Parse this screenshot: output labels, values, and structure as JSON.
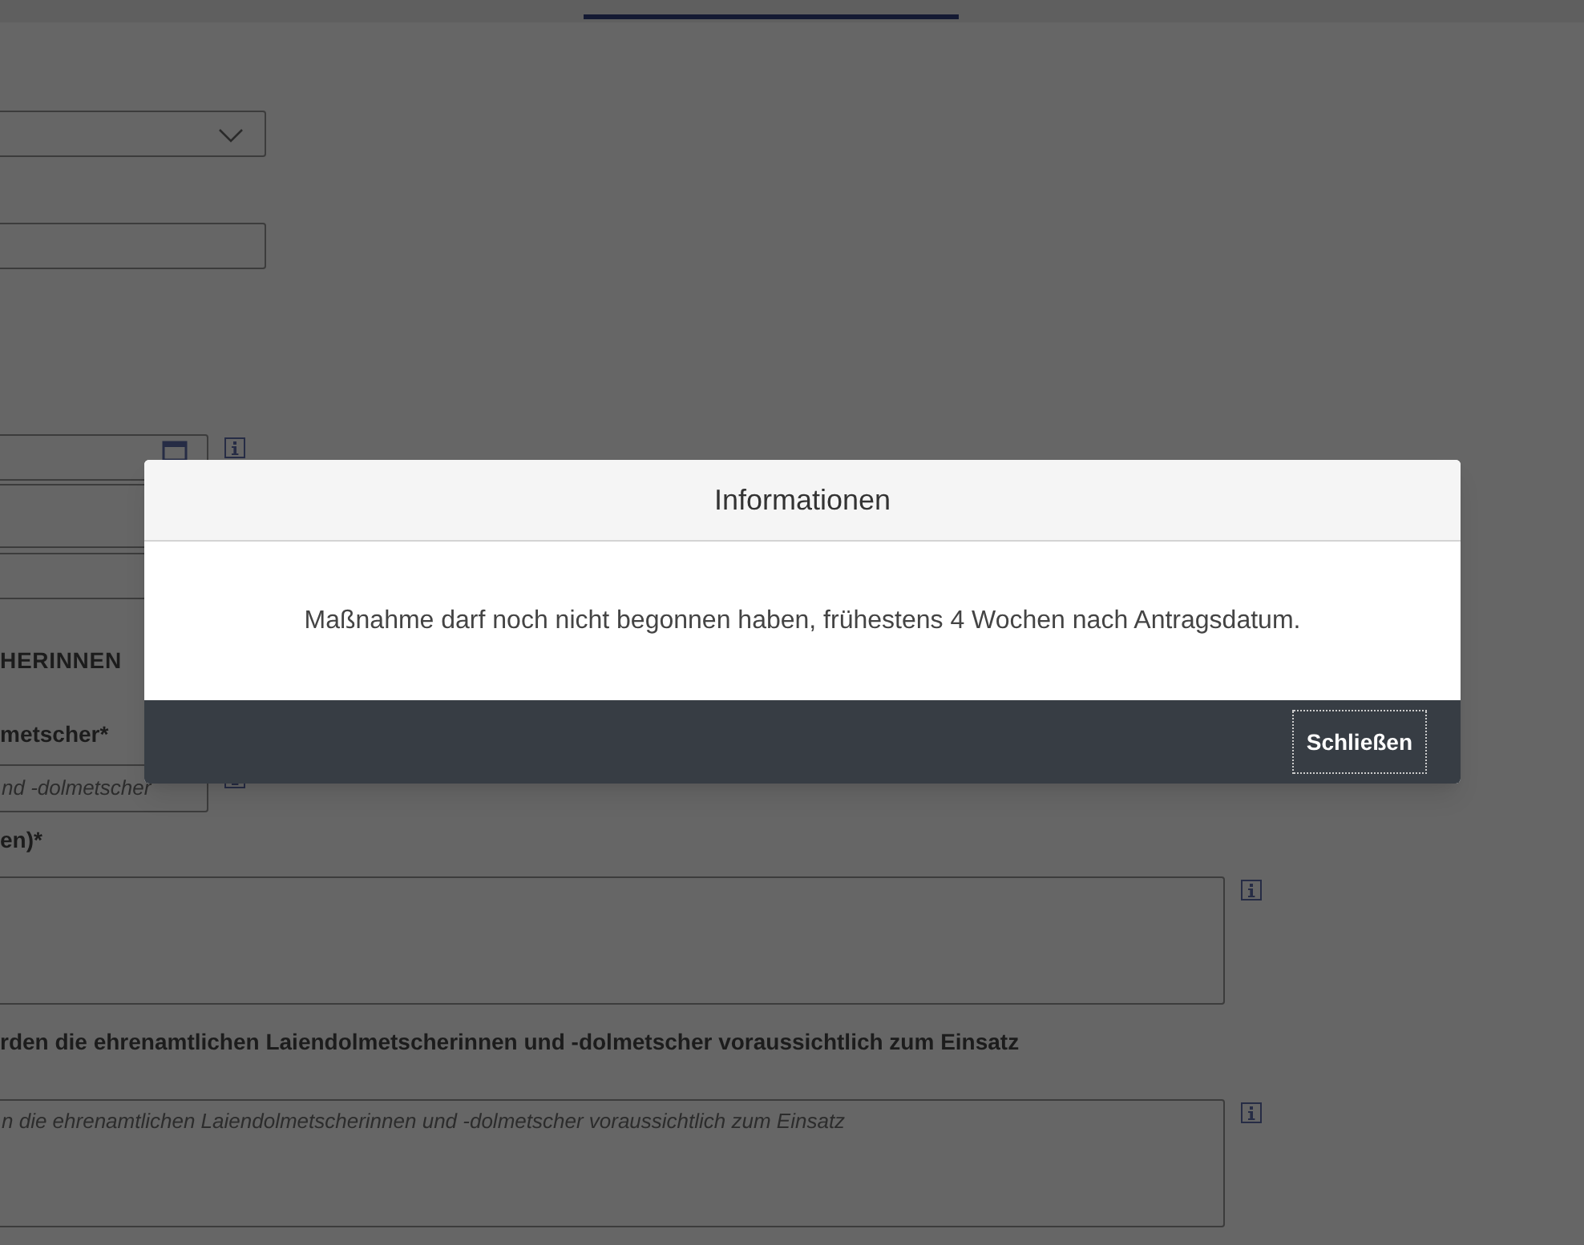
{
  "form": [
    {
      "kind": "select"
    },
    {
      "kind": "input"
    },
    {
      "kind": "date",
      "info": true
    },
    {
      "kind": "input"
    },
    {
      "kind": "input"
    },
    {
      "kind": "heading",
      "text": "HERINNEN"
    },
    {
      "kind": "label",
      "text": "metscher*"
    },
    {
      "kind": "input",
      "placeholder": "nd -dolmetscher",
      "info": true
    },
    {
      "kind": "label",
      "text": "en)*"
    },
    {
      "kind": "textarea",
      "info": true
    },
    {
      "kind": "label",
      "text": "rden die ehrenamtlichen Laiendolmetscherinnen und -dolmetscher voraussichtlich zum Einsatz"
    },
    {
      "kind": "textarea",
      "placeholder": "n die ehrenamtlichen Laiendolmetscherinnen und -dolmetscher voraussichtlich zum Einsatz",
      "info": true
    }
  ],
  "dialog": {
    "title": "Informationen",
    "message": "Maßnahme darf noch nicht begonnen haben, frühestens 4 Wochen nach Antragsdatum.",
    "button": "Schließen"
  }
}
